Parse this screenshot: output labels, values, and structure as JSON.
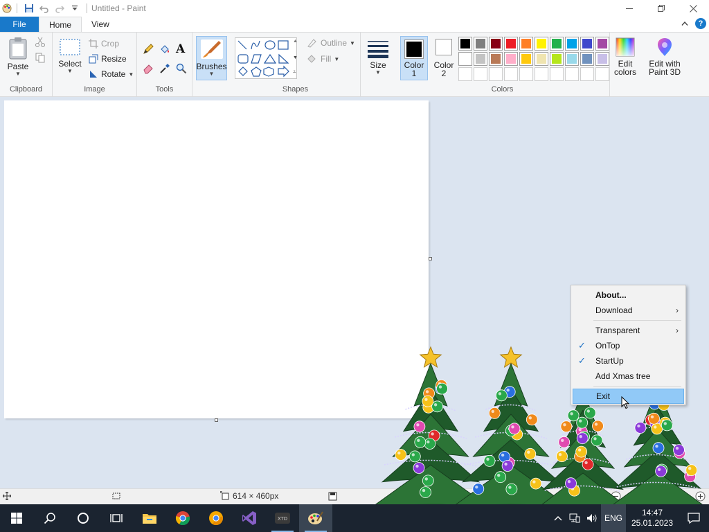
{
  "titlebar": {
    "title": "Untitled - Paint"
  },
  "tabs": {
    "file": "File",
    "home": "Home",
    "view": "View"
  },
  "clipboard": {
    "paste": "Paste",
    "label": "Clipboard"
  },
  "image": {
    "select": "Select",
    "crop": "Crop",
    "resize": "Resize",
    "rotate": "Rotate",
    "label": "Image"
  },
  "tools": {
    "label": "Tools"
  },
  "brushes": {
    "label": "Brushes"
  },
  "shapes": {
    "outline": "Outline",
    "fill": "Fill",
    "label": "Shapes"
  },
  "size": {
    "label": "Size"
  },
  "colors": {
    "color1_line1": "Color",
    "color1_line2": "1",
    "color2_line1": "Color",
    "color2_line2": "2",
    "edit_line1": "Edit",
    "edit_line2": "colors",
    "paint3d_line1": "Edit with",
    "paint3d_line2": "Paint 3D",
    "label": "Colors",
    "palette_row1": [
      "#000000",
      "#7f7f7f",
      "#880015",
      "#ed1c24",
      "#ff7f27",
      "#fff200",
      "#22b14c",
      "#00a2e8",
      "#3f48cc",
      "#a349a4"
    ],
    "palette_row2": [
      "#ffffff",
      "#c3c3c3",
      "#b97a57",
      "#ffaec9",
      "#ffc90e",
      "#efe4b0",
      "#b5e61d",
      "#99d9ea",
      "#7092be",
      "#c8bfe7"
    ],
    "color1": "#000000",
    "color2": "#ffffff"
  },
  "statusbar": {
    "dimensions": "614 × 460px"
  },
  "context_menu": {
    "about": "About...",
    "download": "Download",
    "transparent": "Transparent",
    "ontop": "OnTop",
    "startup": "StartUp",
    "add_tree": "Add Xmas tree",
    "exit": "Exit"
  },
  "taskbar": {
    "lang": "ENG",
    "time": "14:47",
    "date": "25.01.2023"
  }
}
